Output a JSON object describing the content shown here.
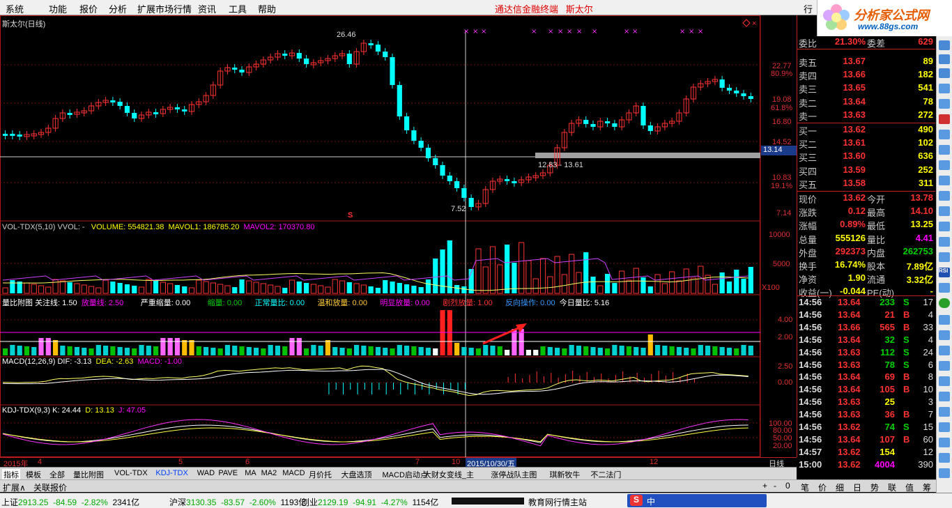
{
  "menu": {
    "items": [
      "系统",
      "功能",
      "报价",
      "分析",
      "扩展市场行情",
      "资讯",
      "工具",
      "帮助"
    ],
    "title": "通达信金融终端",
    "stock": "斯太尔",
    "right": "行"
  },
  "logo": {
    "text": "分析家公式网",
    "url": "www.88gs.com"
  },
  "main": {
    "title": "斯太尔(日线)",
    "high_label": "26.46",
    "low_label": "7.52",
    "range_label": "12.83 - 13.61",
    "price_tag": "13.14",
    "s_mark": "S",
    "axis": [
      "22.77",
      "80.9%",
      "19.08",
      "61.8%",
      "16.80",
      "14.52",
      "10.83",
      "19.1%",
      "7.14"
    ]
  },
  "vol": {
    "title": "VOL-TDX(5,10) VVOL: -",
    "volume": "VOLUME: 554821.38",
    "mavol1": "MAVOL1: 186785.20",
    "mavol2": "MAVOL2: 170370.80",
    "axis": [
      "10000",
      "5000",
      "X100"
    ]
  },
  "lb": {
    "title": "量比附图",
    "gz": "关注线: 1.50",
    "fl": "放量线: 2.50",
    "yz": "严重缩量: 0.00",
    "sl": "缩量: 0.00",
    "zc": "正常量比: 0.00",
    "wh": "温和放量: 0.00",
    "mx": "明显放量: 0.00",
    "jl": "剧烈放量: 1.00",
    "fx": "反向操作: 0.00",
    "jr": "今日量比: 5.16",
    "axis": [
      "4.00",
      "2.00"
    ]
  },
  "macd": {
    "title": "MACD(12,26,9)",
    "dif": "DIF: -3.13",
    "dea": "DEA: -2.63",
    "macd": "MACD: -1.00",
    "axis": [
      "2.50",
      "0.00"
    ]
  },
  "kdj": {
    "title": "KDJ-TDX(9,3)",
    "k": "K: 24.44",
    "d": "D: 13.13",
    "j": "J: 47.05",
    "axis": [
      "100.00",
      "80.00",
      "50.00",
      "20.00"
    ]
  },
  "quote": {
    "wb": {
      "label": "委比",
      "value": "21.30%",
      "label2": "委差",
      "value2": "629"
    },
    "asks": [
      {
        "label": "卖五",
        "price": "13.67",
        "vol": "89"
      },
      {
        "label": "卖四",
        "price": "13.66",
        "vol": "182"
      },
      {
        "label": "卖三",
        "price": "13.65",
        "vol": "541"
      },
      {
        "label": "卖二",
        "price": "13.64",
        "vol": "78"
      },
      {
        "label": "卖一",
        "price": "13.63",
        "vol": "272"
      }
    ],
    "bids": [
      {
        "label": "买一",
        "price": "13.62",
        "vol": "490"
      },
      {
        "label": "买二",
        "price": "13.61",
        "vol": "102"
      },
      {
        "label": "买三",
        "price": "13.60",
        "vol": "636"
      },
      {
        "label": "买四",
        "price": "13.59",
        "vol": "252"
      },
      {
        "label": "买五",
        "price": "13.58",
        "vol": "311"
      }
    ],
    "stats": [
      {
        "l1": "现价",
        "v1": "13.62",
        "c1": "red",
        "l2": "今开",
        "v2": "13.78",
        "c2": "red"
      },
      {
        "l1": "涨跌",
        "v1": "0.12",
        "c1": "red",
        "l2": "最高",
        "v2": "14.10",
        "c2": "red"
      },
      {
        "l1": "涨幅",
        "v1": "0.89%",
        "c1": "red",
        "l2": "最低",
        "v2": "13.25",
        "c2": "yellow"
      },
      {
        "l1": "总量",
        "v1": "555126",
        "c1": "yellow",
        "l2": "量比",
        "v2": "4.41",
        "c2": "mag"
      },
      {
        "l1": "外盘",
        "v1": "292373",
        "c1": "red",
        "l2": "内盘",
        "v2": "262753",
        "c2": "green"
      },
      {
        "l1": "换手",
        "v1": "16.74%",
        "c1": "yellow",
        "l2": "股本",
        "v2": "7.89亿",
        "c2": "yellow"
      },
      {
        "l1": "净资",
        "v1": "1.90",
        "c1": "yellow",
        "l2": "流通",
        "v2": "3.32亿",
        "c2": "yellow"
      },
      {
        "l1": "收益(一)",
        "v1": "-0.044",
        "c1": "yellow",
        "l2": "PE(动)",
        "v2": "-",
        "c2": "yellow"
      }
    ],
    "ticks": [
      {
        "t": "14:56",
        "p": "13.64",
        "v": "233",
        "f": "S",
        "n": "17"
      },
      {
        "t": "14:56",
        "p": "13.64",
        "v": "21",
        "f": "B",
        "n": "4"
      },
      {
        "t": "14:56",
        "p": "13.66",
        "v": "565",
        "f": "B",
        "n": "33"
      },
      {
        "t": "14:56",
        "p": "13.64",
        "v": "32",
        "f": "S",
        "n": "4"
      },
      {
        "t": "14:56",
        "p": "13.63",
        "v": "112",
        "f": "S",
        "n": "24"
      },
      {
        "t": "14:56",
        "p": "13.63",
        "v": "78",
        "f": "S",
        "n": "6"
      },
      {
        "t": "14:56",
        "p": "13.64",
        "v": "69",
        "f": "B",
        "n": "8"
      },
      {
        "t": "14:56",
        "p": "13.64",
        "v": "105",
        "f": "B",
        "n": "10"
      },
      {
        "t": "14:56",
        "p": "13.63",
        "v": "25",
        "f": "",
        "n": "3"
      },
      {
        "t": "14:56",
        "p": "13.63",
        "v": "36",
        "f": "B",
        "n": "7"
      },
      {
        "t": "14:56",
        "p": "13.62",
        "v": "74",
        "f": "S",
        "n": "15"
      },
      {
        "t": "14:56",
        "p": "13.64",
        "v": "107",
        "f": "B",
        "n": "60"
      },
      {
        "t": "14:57",
        "p": "13.62",
        "v": "154",
        "f": "",
        "n": "12"
      },
      {
        "t": "15:00",
        "p": "13.62",
        "v": "4004",
        "f": "",
        "n": "390"
      }
    ]
  },
  "dateaxis": {
    "year": "2015年",
    "m4": "4",
    "m5": "5",
    "m6": "6",
    "m7": "7",
    "m10": "10",
    "cursor": "2015/10/30/五",
    "m12": "12",
    "period": "日线"
  },
  "tabs": [
    "指标",
    "模板",
    "全部",
    "量比附图",
    "VOL-TDX",
    "KDJ-TDX",
    "WAD",
    "PAVE",
    "MA",
    "MA2",
    "MACD",
    "月价托",
    "大盘选顶",
    "MACD启动点",
    "大财女变线_主",
    "涨停战队主图",
    "琪新牧牛",
    "不二法门"
  ],
  "tabs2": [
    "扩展∧",
    "关联报价"
  ],
  "btabs": [
    "笔",
    "价",
    "细",
    "日",
    "势",
    "联",
    "值",
    "筹"
  ],
  "status": {
    "sh": "上证",
    "sh_v": "2913.25",
    "sh_c": "-84.59",
    "sh_p": "-2.82%",
    "sh_a": "2341亿",
    "sz": "沪深",
    "sz_v": "3130.35",
    "sz_c": "-83.57",
    "sz_p": "-2.60%",
    "sz_a": "1193亿",
    "cy": "创业",
    "cy_v": "2129.19",
    "cy_c": "-94.91",
    "cy_p": "-4.27%",
    "cy_a": "1154亿",
    "ticker": "教育网行情主站",
    "ime": "中"
  },
  "colors": {
    "up": "#ff3232",
    "down": "#00ffff",
    "yellow": "#ffff00",
    "magenta": "#ff00ff"
  }
}
